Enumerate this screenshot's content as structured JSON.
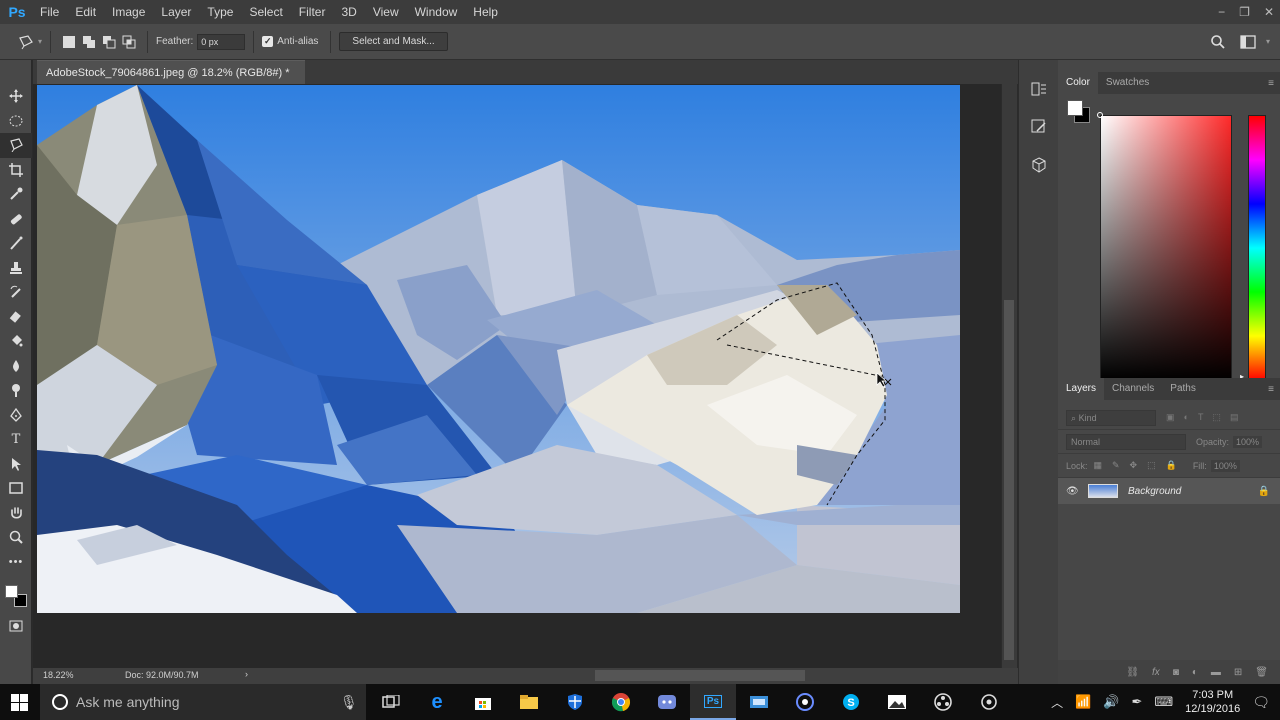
{
  "app": {
    "logo": "Ps"
  },
  "menu": [
    "File",
    "Edit",
    "Image",
    "Layer",
    "Type",
    "Select",
    "Filter",
    "3D",
    "View",
    "Window",
    "Help"
  ],
  "window_controls": {
    "minimize": "−",
    "restore": "❐",
    "close": "✕"
  },
  "options": {
    "feather_label": "Feather:",
    "feather_value": "0 px",
    "antialias_label": "Anti-alias",
    "antialias_checked": "✓",
    "select_mask_label": "Select and Mask..."
  },
  "document": {
    "tab_title": "AdobeStock_79064861.jpeg @ 18.2% (RGB/8#) *",
    "tab_close": "×"
  },
  "status": {
    "zoom": "18.22%",
    "doc_info": "Doc: 92.0M/90.7M",
    "arrow": "›"
  },
  "color_panel": {
    "tabs": [
      "Color",
      "Swatches"
    ],
    "fg_color": "#ffffff",
    "bg_color": "#000000"
  },
  "layers_panel": {
    "tabs": [
      "Layers",
      "Channels",
      "Paths"
    ],
    "kind_label": "Kind",
    "blend_mode": "Normal",
    "opacity_label": "Opacity:",
    "opacity_value": "100%",
    "lock_label": "Lock:",
    "fill_label": "Fill:",
    "fill_value": "100%",
    "layers": [
      {
        "name": "Background",
        "locked": true,
        "visible": true
      }
    ]
  },
  "taskbar": {
    "search_placeholder": "Ask me anything",
    "clock_time": "7:03 PM",
    "clock_date": "12/19/2016"
  },
  "icons": {
    "accent": "#31a8ff"
  }
}
